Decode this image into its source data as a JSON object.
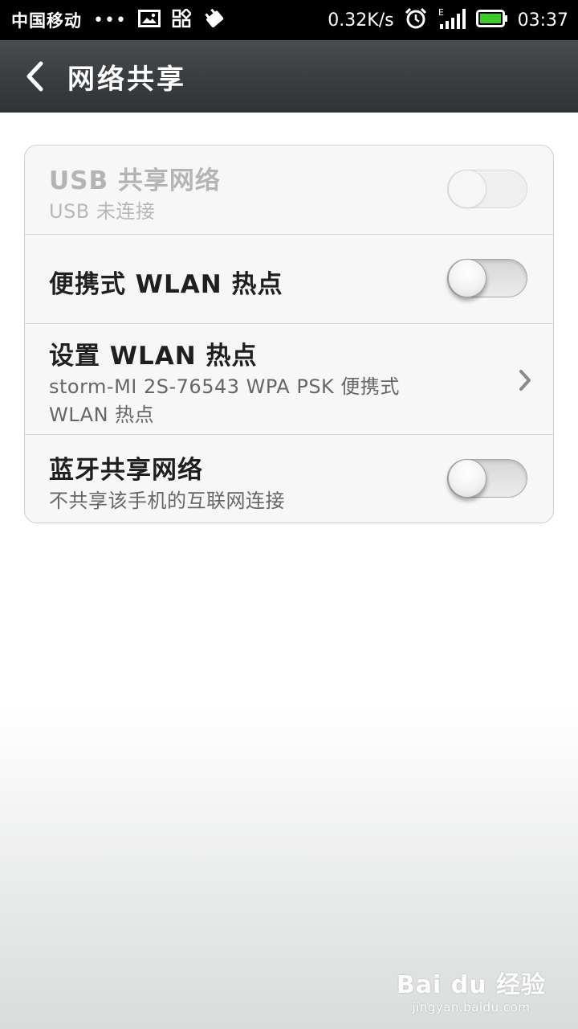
{
  "status_bar": {
    "carrier": "中国移动",
    "dots": "•••",
    "speed": "0.32K/s",
    "network_type": "E",
    "time": "03:37",
    "icons": [
      "image-icon",
      "apps-grid-icon",
      "usb-debug-icon",
      "alarm-clock-icon",
      "signal-icon",
      "battery-icon"
    ]
  },
  "header": {
    "title": "网络共享",
    "back_icon": "chevron-left-icon"
  },
  "settings": {
    "usb": {
      "title": "USB 共享网络",
      "subtitle": "USB 未连接",
      "enabled": false,
      "toggle_on": false
    },
    "portable_hotspot": {
      "title": "便携式 WLAN 热点",
      "toggle_on": false
    },
    "hotspot_setup": {
      "title": "设置 WLAN 热点",
      "subtitle_line1": "storm-MI 2S-76543 WPA PSK 便携式",
      "subtitle_line2": "WLAN 热点"
    },
    "bluetooth": {
      "title": "蓝牙共享网络",
      "subtitle": "不共享该手机的互联网连接",
      "toggle_on": false
    }
  },
  "colors": {
    "status_bar_bg": "#000000",
    "action_bar_bg": "#3a3d40",
    "card_bg": "#f7f7f7",
    "battery_green": "#3ecb2a"
  },
  "watermark": {
    "logo": "Bai du 经验",
    "url": "jingyan.baidu.com"
  }
}
